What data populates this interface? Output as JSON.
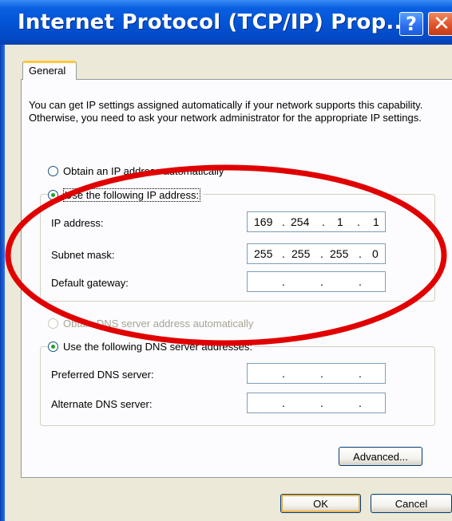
{
  "window": {
    "title": "Internet Protocol (TCP/IP) Prop...",
    "help_label": "?",
    "close_label": "✕"
  },
  "tabs": [
    {
      "label": "General"
    }
  ],
  "description": "You can get IP settings assigned automatically if your network supports this capability. Otherwise, you need to ask your network administrator for the appropriate IP settings.",
  "ip_section": {
    "auto_option": "Obtain an IP address automatically",
    "manual_option": "Use the following IP address:",
    "selected": "manual",
    "fields": [
      {
        "label": "IP address:",
        "octets": [
          "169",
          "254",
          "1",
          "1"
        ]
      },
      {
        "label": "Subnet mask:",
        "octets": [
          "255",
          "255",
          "255",
          "0"
        ]
      },
      {
        "label": "Default gateway:",
        "octets": [
          "",
          "",
          "",
          ""
        ]
      }
    ]
  },
  "dns_section": {
    "auto_option": "Obtain DNS server address automatically",
    "auto_disabled": true,
    "manual_option": "Use the following DNS server addresses:",
    "selected": "manual",
    "fields": [
      {
        "label": "Preferred DNS server:",
        "octets": [
          "",
          "",
          "",
          ""
        ]
      },
      {
        "label": "Alternate DNS server:",
        "octets": [
          "",
          "",
          "",
          ""
        ]
      }
    ]
  },
  "buttons": {
    "advanced": "Advanced...",
    "ok": "OK",
    "cancel": "Cancel"
  },
  "colors": {
    "annotation_ellipse": "#e00000",
    "titlebar": "#0354d6",
    "radio_dot": "#21a121"
  }
}
